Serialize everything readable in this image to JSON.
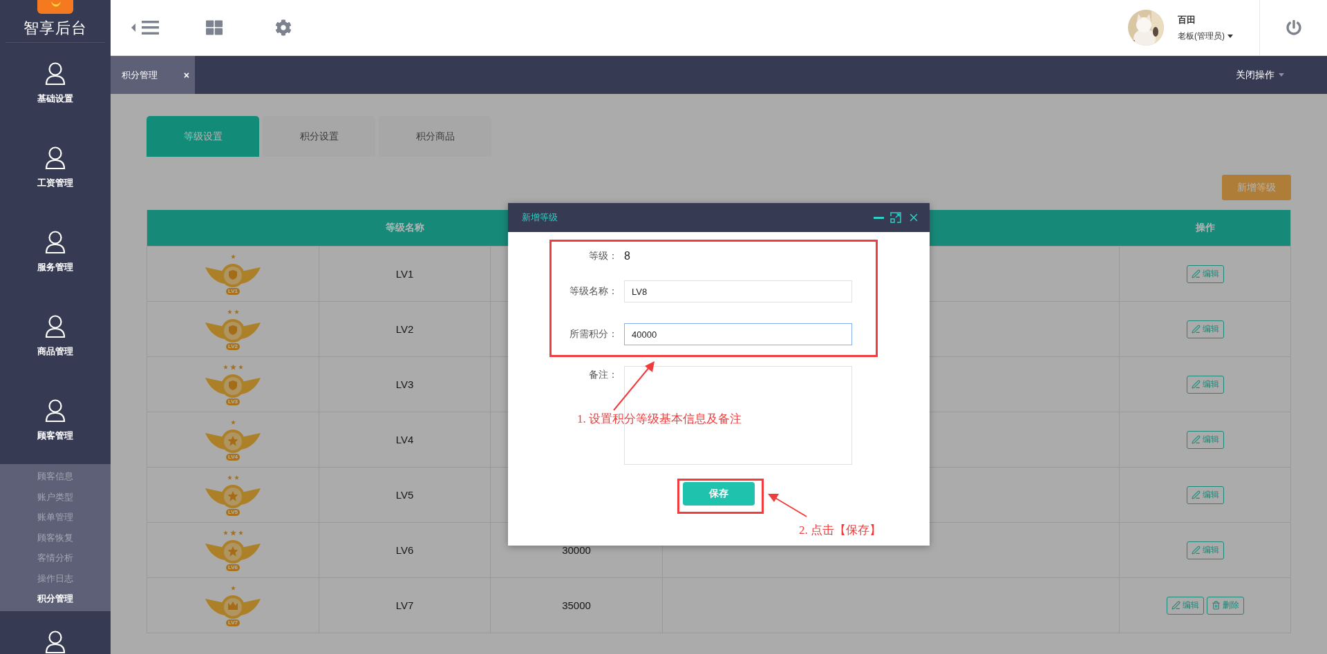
{
  "sidebar": {
    "logo": "智享后台",
    "items": [
      {
        "kind": "menu",
        "label": "基础设置"
      },
      {
        "kind": "menu",
        "label": "工资管理"
      },
      {
        "kind": "menu",
        "label": "服务管理"
      },
      {
        "kind": "menu",
        "label": "商品管理"
      },
      {
        "kind": "menu",
        "label": "顾客管理",
        "children": [
          {
            "label": "顾客信息",
            "selected": false
          },
          {
            "label": "账户类型",
            "selected": false
          },
          {
            "label": "账单管理",
            "selected": false
          },
          {
            "label": "顾客恢复",
            "selected": false
          },
          {
            "label": "客情分析",
            "selected": false
          },
          {
            "label": "操作日志",
            "selected": false
          },
          {
            "label": "积分管理",
            "selected": true
          }
        ]
      },
      {
        "kind": "menu"
      }
    ]
  },
  "header": {
    "user": {
      "name": "百田",
      "role": "老板(管理员)"
    }
  },
  "open_tabs": [
    {
      "label": "积分管理",
      "selected": true,
      "close": "×"
    }
  ],
  "close_menu": "关闭操作",
  "tabs": [
    {
      "label": "等级设置",
      "selected": true
    },
    {
      "label": "积分设置",
      "selected": false
    },
    {
      "label": "积分商品",
      "selected": false
    }
  ],
  "new_button": "新增等级",
  "table": {
    "columns": [
      {
        "label": "等级名称"
      },
      {
        "label": "操作"
      }
    ],
    "rows": [
      {
        "name": "LV1",
        "badge": "LV1",
        "kind": "shield1",
        "actions": [
          {
            "kind": "edit",
            "label": "编辑"
          }
        ]
      },
      {
        "name": "LV2",
        "badge": "LV2",
        "kind": "shield2",
        "actions": [
          {
            "kind": "edit",
            "label": "编辑"
          }
        ]
      },
      {
        "name": "LV3",
        "badge": "LV3",
        "kind": "shield3",
        "actions": [
          {
            "kind": "edit",
            "label": "编辑"
          }
        ]
      },
      {
        "name": "LV4",
        "badge": "LV4",
        "kind": "star1",
        "actions": [
          {
            "kind": "edit",
            "label": "编辑"
          }
        ]
      },
      {
        "name": "LV5",
        "badge": "LV5",
        "kind": "star2",
        "actions": [
          {
            "kind": "edit",
            "label": "编辑"
          }
        ]
      },
      {
        "name": "LV6",
        "badge": "LV6",
        "kind": "star3",
        "points": "30000",
        "actions": [
          {
            "kind": "edit",
            "label": "编辑"
          }
        ]
      },
      {
        "name": "LV7",
        "badge": "LV7",
        "kind": "crown1",
        "points": "35000",
        "actions": [
          {
            "kind": "edit",
            "label": "编辑"
          },
          {
            "kind": "delete",
            "label": "删除"
          }
        ]
      }
    ]
  },
  "dialog": {
    "title": "新增等级",
    "fields": [
      {
        "kind": "text",
        "label": "等级：",
        "value": "8"
      },
      {
        "kind": "input",
        "label": "等级名称：",
        "value": "LV8",
        "focused": false
      },
      {
        "kind": "input",
        "label": "所需积分：",
        "value": "40000",
        "focused": true
      },
      {
        "kind": "textarea",
        "label": "备注："
      }
    ],
    "save": "保存"
  },
  "annotations": [
    {
      "text": "1. 设置积分等级基本信息及备注"
    },
    {
      "text": "2. 点击【保存】"
    }
  ]
}
